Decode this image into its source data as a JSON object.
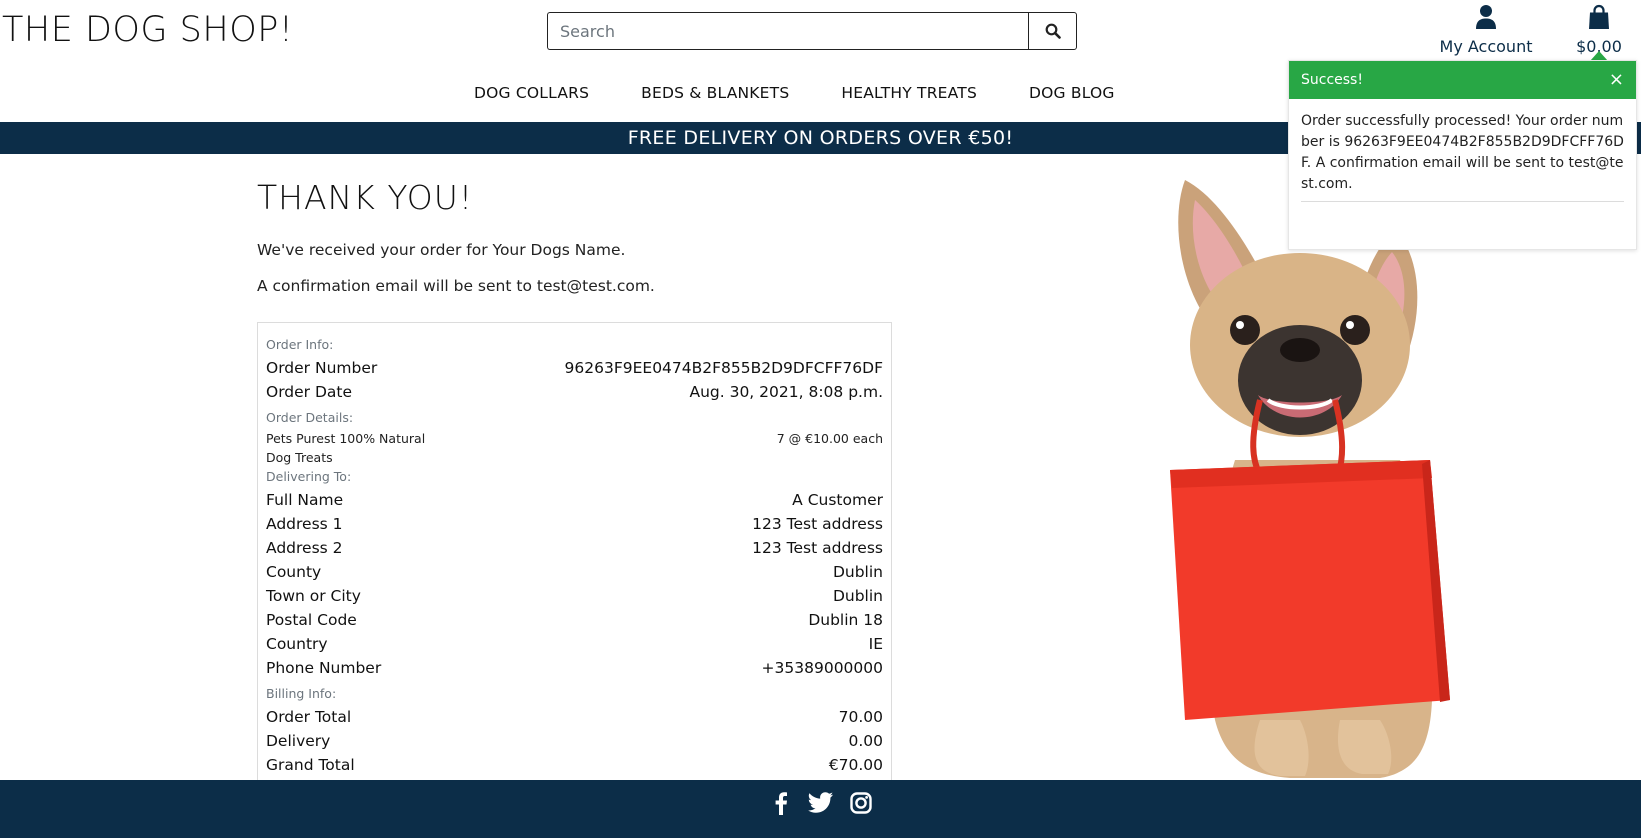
{
  "header": {
    "logo": "THE DOG SHOP!",
    "search": {
      "placeholder": "Search",
      "value": ""
    },
    "account_label": "My Account",
    "bag_total": "$0.00"
  },
  "nav": {
    "items": [
      "DOG COLLARS",
      "BEDS & BLANKETS",
      "HEALTHY TREATS",
      "DOG BLOG"
    ]
  },
  "banner": "FREE DELIVERY ON ORDERS OVER €50!",
  "main": {
    "title": "THANK YOU!",
    "received_line": "We've received your order for Your Dogs Name.",
    "email_line": "A confirmation email will be sent to test@test.com."
  },
  "order": {
    "order_info_label": "Order Info:",
    "order_number_label": "Order Number",
    "order_number": "96263F9EE0474B2F855B2D9DFCFF76DF",
    "order_date_label": "Order Date",
    "order_date": "Aug. 30, 2021, 8:08 p.m.",
    "details_label": "Order Details:",
    "items": [
      {
        "name": "Pets Purest 100% Natural Dog Treats",
        "qty": "7 @ €10.00 each"
      }
    ],
    "delivering_label": "Delivering To:",
    "delivery": [
      {
        "label": "Full Name",
        "value": "A Customer"
      },
      {
        "label": "Address 1",
        "value": "123 Test address"
      },
      {
        "label": "Address 2",
        "value": "123 Test address"
      },
      {
        "label": "County",
        "value": "Dublin"
      },
      {
        "label": "Town or City",
        "value": "Dublin"
      },
      {
        "label": "Postal Code",
        "value": "Dublin 18"
      },
      {
        "label": "Country",
        "value": "IE"
      },
      {
        "label": "Phone Number",
        "value": "+35389000000"
      }
    ],
    "billing_label": "Billing Info:",
    "billing": [
      {
        "label": "Order Total",
        "value": "70.00"
      },
      {
        "label": "Delivery",
        "value": "0.00"
      },
      {
        "label": "Grand Total",
        "value": "€70.00"
      }
    ]
  },
  "toast": {
    "title": "Success!",
    "close": "×",
    "message": "Order successfully processed! Your order number is 96263F9EE0474B2F855B2D9DFCFF76DF. A confirmation email will be sent to test@test.com."
  },
  "footer": {
    "icons": [
      "facebook-icon",
      "twitter-icon",
      "instagram-icon"
    ]
  },
  "colors": {
    "navy": "#0c2d48",
    "success": "#28a745",
    "bag_red": "#f23a2a"
  }
}
